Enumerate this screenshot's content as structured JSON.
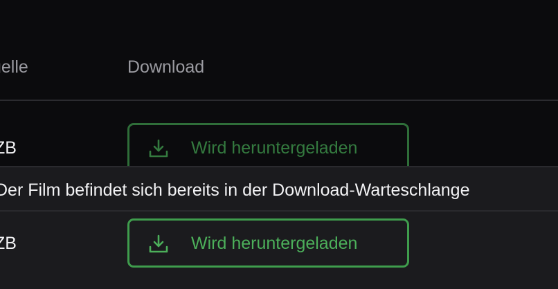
{
  "table": {
    "headers": {
      "source": "uelle",
      "download": "Download"
    },
    "rows": [
      {
        "source": "ZB",
        "download_label": "Wird heruntergeladen",
        "download_icon": "download-icon"
      },
      {
        "source": "ZB",
        "download_label": "Wird heruntergeladen",
        "download_icon": "download-icon"
      }
    ]
  },
  "tooltip": {
    "text": "Der Film befindet sich bereits in der Download-Warteschlange"
  },
  "colors": {
    "background": "#0b0b0d",
    "row_hover": "#1b1b1e",
    "accent_green": "#4caf5a",
    "header_text": "#9b9ba1"
  }
}
